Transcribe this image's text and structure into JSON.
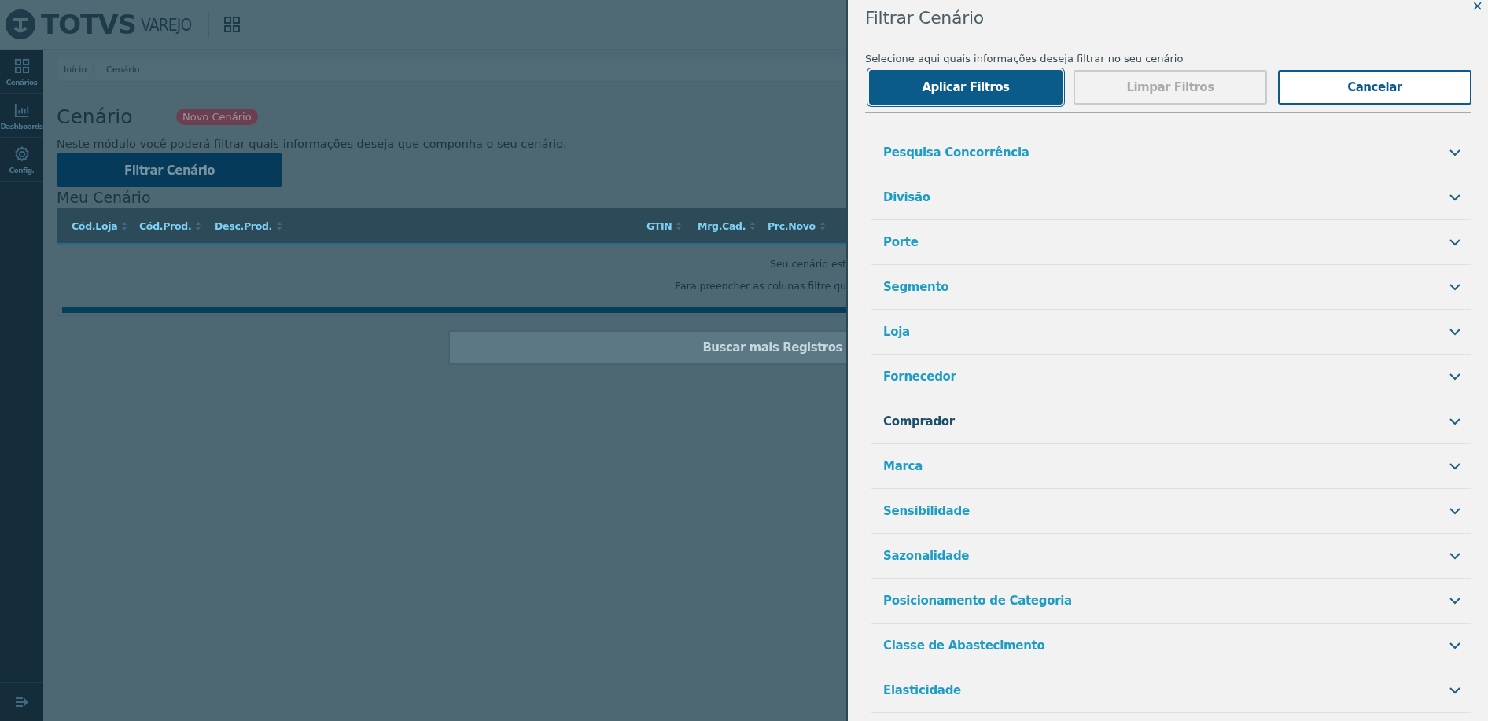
{
  "header": {
    "brand": "TOTVS",
    "product": "VAREJO"
  },
  "sidebar": {
    "items": [
      {
        "label": "Cenários",
        "kind": "grid"
      },
      {
        "label": "Dashboards",
        "kind": "chart"
      },
      {
        "label": "Config.",
        "kind": "gear"
      }
    ]
  },
  "breadcrumb": [
    "Início",
    "Cenário"
  ],
  "page": {
    "title": "Cenário",
    "badge": "Novo Cenário",
    "description": "Neste módulo você poderá filtrar quais informações deseja que componha o seu cenário.",
    "filter_button": "Filtrar Cenário",
    "section_title": "Meu Cenário"
  },
  "table": {
    "columns": [
      "Cód.Loja",
      "Cód.Prod.",
      "Desc.Prod.",
      "GTIN",
      "Mrg.Cad.",
      "Prc.Novo"
    ],
    "empty_lines": [
      "Seu cenário est",
      "Para preencher as colunas filtre qu"
    ]
  },
  "load_more_button": {
    "label": "Buscar mais Registros",
    "disabled": true
  },
  "filter_panel": {
    "title": "Filtrar Cenário",
    "close": "×",
    "subtitle": "Selecione aqui quais informações deseja filtrar no seu cenário",
    "buttons": [
      {
        "label": "Aplicar Filtros",
        "kind": "primary"
      },
      {
        "label": "Limpar Filtros",
        "kind": "disabled"
      },
      {
        "label": "Cancelar",
        "kind": "outline"
      }
    ],
    "sections": [
      {
        "label": "Pesquisa Concorrência",
        "hovered": false
      },
      {
        "label": "Divisão",
        "hovered": false
      },
      {
        "label": "Porte",
        "hovered": false
      },
      {
        "label": "Segmento",
        "hovered": false
      },
      {
        "label": "Loja",
        "hovered": false
      },
      {
        "label": "Fornecedor",
        "hovered": false
      },
      {
        "label": "Comprador",
        "hovered": true
      },
      {
        "label": "Marca",
        "hovered": false
      },
      {
        "label": "Sensibilidade",
        "hovered": false
      },
      {
        "label": "Sazonalidade",
        "hovered": false
      },
      {
        "label": "Posicionamento de Categoria",
        "hovered": false
      },
      {
        "label": "Classe de Abastecimento",
        "hovered": false
      },
      {
        "label": "Elasticidade",
        "hovered": false
      }
    ]
  }
}
